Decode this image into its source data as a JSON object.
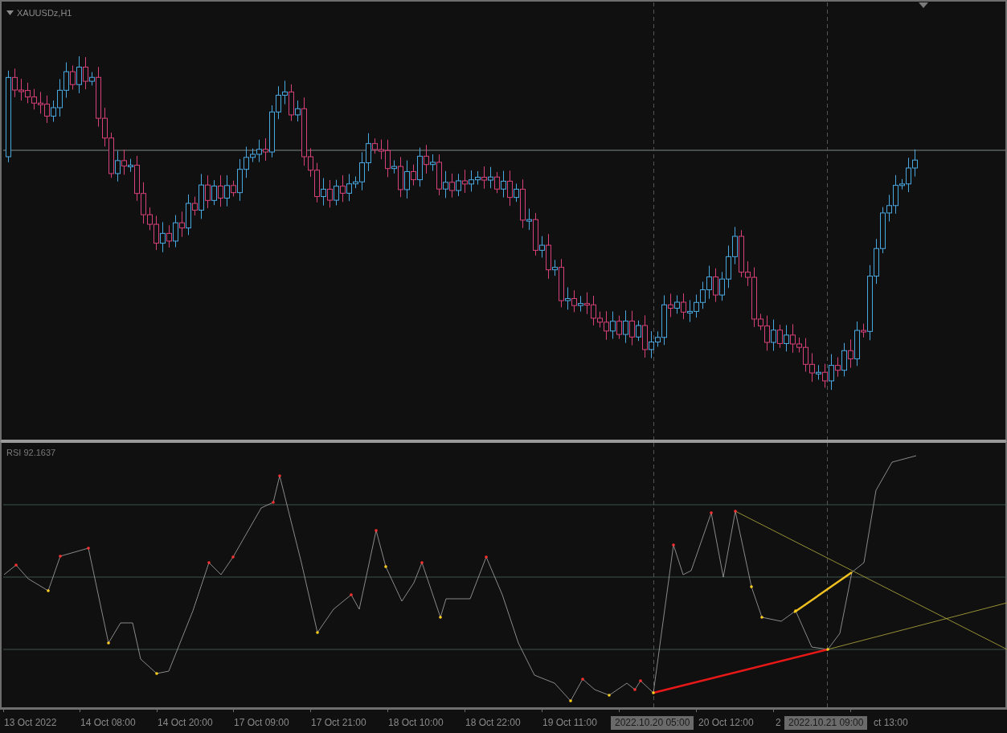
{
  "price_pane": {
    "symbol": "XAUUSDz,H1",
    "kind": "picture"
  },
  "indicator_pane": {
    "label": "RSI 92.1637",
    "kind": "picture"
  },
  "time_axis": [
    {
      "text": "13 Oct 2022",
      "kind": "label"
    },
    {
      "text": "14 Oct 08:00",
      "kind": "label"
    },
    {
      "text": "14 Oct 20:00",
      "kind": "label"
    },
    {
      "text": "17 Oct 09:00",
      "kind": "label"
    },
    {
      "text": "17 Oct 21:00",
      "kind": "label"
    },
    {
      "text": "18 Oct 10:00",
      "kind": "label"
    },
    {
      "text": "18 Oct 22:00",
      "kind": "label"
    },
    {
      "text": "19 Oct 11:00",
      "kind": "label"
    },
    {
      "text": "2022.10.20 05:00",
      "kind": "crosshair"
    },
    {
      "text": "20 Oct 12:00",
      "kind": "label"
    },
    {
      "text": "2",
      "kind": "label"
    },
    {
      "text": "2022.10.21 09:00",
      "kind": "crosshair"
    },
    {
      "text": "ct 13:00",
      "kind": "label"
    }
  ]
}
